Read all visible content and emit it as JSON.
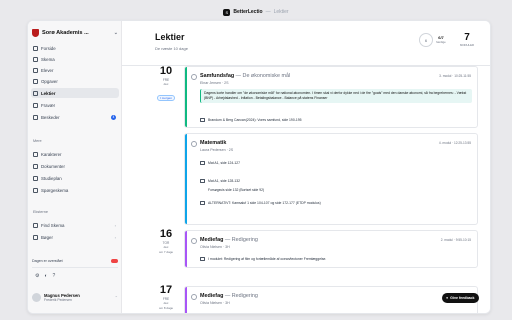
{
  "titlebar": {
    "logo_text": "S",
    "app": "BetterLectio",
    "separator": "—",
    "page": "Lektier"
  },
  "sidebar": {
    "school": "Sorø Akademis ...",
    "nav": [
      {
        "label": "Forside",
        "icon": "home-icon"
      },
      {
        "label": "Skema",
        "icon": "calendar-icon"
      },
      {
        "label": "Elever",
        "icon": "users-icon"
      },
      {
        "label": "Opgaver",
        "icon": "clipboard-icon"
      },
      {
        "label": "Lektier",
        "icon": "book-icon",
        "active": true
      },
      {
        "label": "Fravær",
        "icon": "clock-icon"
      },
      {
        "label": "Beskeder",
        "icon": "message-icon",
        "badge": "4"
      }
    ],
    "more_label": "Mere",
    "more": [
      {
        "label": "Karakterer",
        "icon": "grade-icon"
      },
      {
        "label": "Dokumenter",
        "icon": "folder-icon"
      },
      {
        "label": "Studieplan",
        "icon": "plan-icon"
      },
      {
        "label": "Spørgeskema",
        "icon": "survey-icon"
      }
    ],
    "elsewhere_label": "Eksterne",
    "elsewhere": [
      {
        "label": "Find Skema",
        "icon": "search-icon"
      },
      {
        "label": "Bøger",
        "icon": "books-icon"
      }
    ],
    "theme_label": "Dagen er overstået",
    "user": {
      "name": "Magnus Pedersen",
      "sub": "Frederik Pedersen"
    }
  },
  "header": {
    "title": "Lektier",
    "subtitle": "De næste 10 dage",
    "stat_circle": "6",
    "stat1_num": "6/7",
    "stat1_label": "færdige",
    "stat2_num": "7",
    "stat2_label": "MODULER"
  },
  "days": [
    {
      "day": "10",
      "weekday": "FRE",
      "month": "dec",
      "tag": "I morgen"
    },
    {
      "day": "16",
      "weekday": "TOR",
      "month": "dec",
      "rel": "om 7 dage"
    },
    {
      "day": "17",
      "weekday": "FRE",
      "month": "dec",
      "rel": "om 8 dage"
    }
  ],
  "cards": [
    {
      "subject": "Samfundsfag",
      "topic": "De økonomiske mål",
      "teacher": "Elnar Jensen · 2S",
      "time": "3. modul · 10:25-11:55",
      "note": "Dagens korte handler om \"de økonomiske mål\" for national økonomien. I timen skal vi derfor dykke ned i de fire \"goals\" med den danske økonomi, så fra begrebernes: - Vækst (BNP) - Arbejdsløshed - Inflation - Betalingsbalance - Balance på statens Finanser",
      "rows": [
        {
          "text": "Brandum & Berg Cancan(2024): Vores samfund, side 190-195"
        }
      ]
    },
    {
      "subject": "Matematik",
      "topic": "",
      "teacher": "Laura Pedersen · 2S",
      "time": "4. modul · 12:25-13:55",
      "rows": [
        {
          "text": "Mat A1, side 124-127"
        },
        {
          "text": "Mat A1, side 128-132",
          "sub": "Forsøgsvis side 132 (Bortset side 92)"
        },
        {
          "text": "ALTERNATIVT: Kamsaluf 1 side 104-107 og side 172-177 (ETDP modulus)"
        }
      ]
    },
    {
      "subject": "Mediefag",
      "topic": "Redigering",
      "teacher": "Olivia Nielsen · 3H",
      "time": "2. modul · 9:55-10:15",
      "rows": [
        {
          "text": "I modulet: Redigering af film og fortællemåde af ocean/tectoner Fremlæggelse."
        }
      ]
    },
    {
      "subject": "Mediefag",
      "topic": "Redigering",
      "teacher": "Olivia Nielsen · 3H",
      "time": "1. modul · 8:15-9:45",
      "rows": []
    }
  ],
  "feedback": "Give feedback",
  "colors": {
    "accent": "#2563eb",
    "samfundsfag": "#10b981",
    "matematik": "#0ea5e9",
    "mediefag": "#a855f7"
  }
}
